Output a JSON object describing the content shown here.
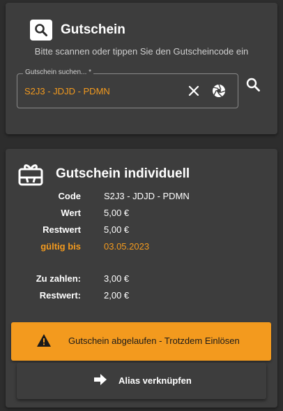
{
  "search_card": {
    "title": "Gutschein",
    "subtitle": "Bitte scannen oder tippen Sie den Gutscheincode ein",
    "field_label": "Gutschein suchen... *",
    "field_value": "S2J3 - JDJD - PDMN",
    "icons": [
      "search-icon",
      "clear-icon",
      "camera-shutter-icon",
      "search-icon"
    ]
  },
  "detail_card": {
    "title": "Gutschein individuell",
    "icon": "gift-card-icon",
    "rows": [
      {
        "key": "Code",
        "value": "S2J3 - JDJD - PDMN"
      },
      {
        "key": "Wert",
        "value": "5,00 €"
      },
      {
        "key": "Restwert",
        "value": "5,00 €"
      },
      {
        "key": "gültig bis",
        "value": "03.05.2023"
      },
      {
        "key": "Zu zahlen:",
        "value": "3,00 €"
      },
      {
        "key": "Restwert:",
        "value": "2,00 €"
      }
    ],
    "expired_button": "Gutschein abgelaufen - Trotzdem Einlösen",
    "alias_button": "Alias verknüpfen"
  },
  "colors": {
    "background": "#2d2d2d",
    "card": "#3d3d3d",
    "accent": "#f39a1e"
  }
}
